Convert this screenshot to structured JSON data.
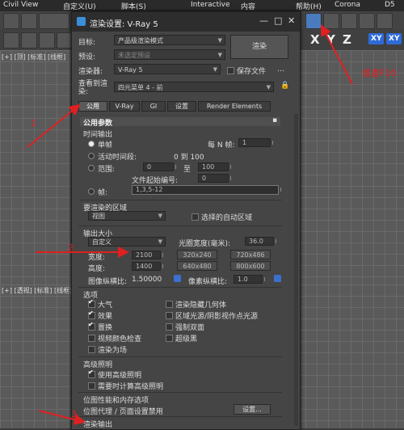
{
  "menubar": {
    "items": [
      "Civil View",
      "自定义(U)",
      "脚本(S)",
      "Interactive",
      "内容",
      "帮助(H)",
      "Corona",
      "D5"
    ]
  },
  "viewport": {
    "top_label": "[+] [顶] [标准] [线框]",
    "bottom_label": "[+] [透视] [标准] [线框]"
  },
  "axis_buttons": [
    "X",
    "Y",
    "Z",
    "XY",
    "XY"
  ],
  "dialog": {
    "title": "渲染设置: V-Ray 5",
    "target_label": "目标:",
    "target_value": "产品级渲染模式",
    "preset_label": "预设:",
    "preset_value": "未选定预设",
    "renderer_label": "渲染器:",
    "renderer_value": "V-Ray 5",
    "save_file_label": "保存文件",
    "render_button": "渲染",
    "view_label": "查看到渲染:",
    "view_value": "四元菜单 4 - 前",
    "tabs": [
      "公用",
      "V-Ray",
      "GI",
      "设置",
      "Render Elements"
    ],
    "common_params": "公用参数",
    "time_output": "时间输出",
    "single": "单帧",
    "every_n_label": "每 N 帧:",
    "every_n_value": "1",
    "active_segment": "活动时间段:",
    "active_range": "0 到 100",
    "range_label": "范围:",
    "range_from": "0",
    "range_to_label": "至",
    "range_to": "100",
    "file_start_label": "文件起始编号:",
    "file_start_value": "0",
    "frames_label": "帧:",
    "frames_value": "1,3,5-12",
    "area_title": "要渲染的区域",
    "area_value": "视图",
    "auto_region": "选择的自动区域",
    "output_size": "输出大小",
    "size_preset": "自定义",
    "aperture_label": "光圈宽度(毫米):",
    "aperture_value": "36.0",
    "width_label": "宽度:",
    "width_value": "2100",
    "height_label": "高度:",
    "height_value": "1400",
    "presets": [
      "320x240",
      "720x486",
      "640x480",
      "800x600"
    ],
    "image_aspect_label": "图像纵横比:",
    "image_aspect_value": "1.50000",
    "pixel_aspect_label": "像素纵横比:",
    "pixel_aspect_value": "1.0",
    "options_title": "选项",
    "options": {
      "atmosphere": "大气",
      "render_hidden": "渲染隐藏几何体",
      "effects": "效果",
      "area_lights": "区域光源/阴影视作点光源",
      "displacement": "置换",
      "force_2side": "强制双面",
      "video_color": "视频颜色检查",
      "super_black": "超级黑",
      "render_fields": "渲染为场"
    },
    "adv_light_title": "高级照明",
    "use_adv_light": "使用高级照明",
    "compute_adv_light": "需要时计算高级照明",
    "bitmap_perf": "位图性能和内存选项",
    "bitmap_proxy": "位图代理 / 页面设置禁用",
    "settings_button": "设置...",
    "render_output": "渲染输出"
  },
  "annotations": {
    "n1": "1",
    "n2": "2",
    "n3": "3",
    "f10": "或者F10"
  }
}
